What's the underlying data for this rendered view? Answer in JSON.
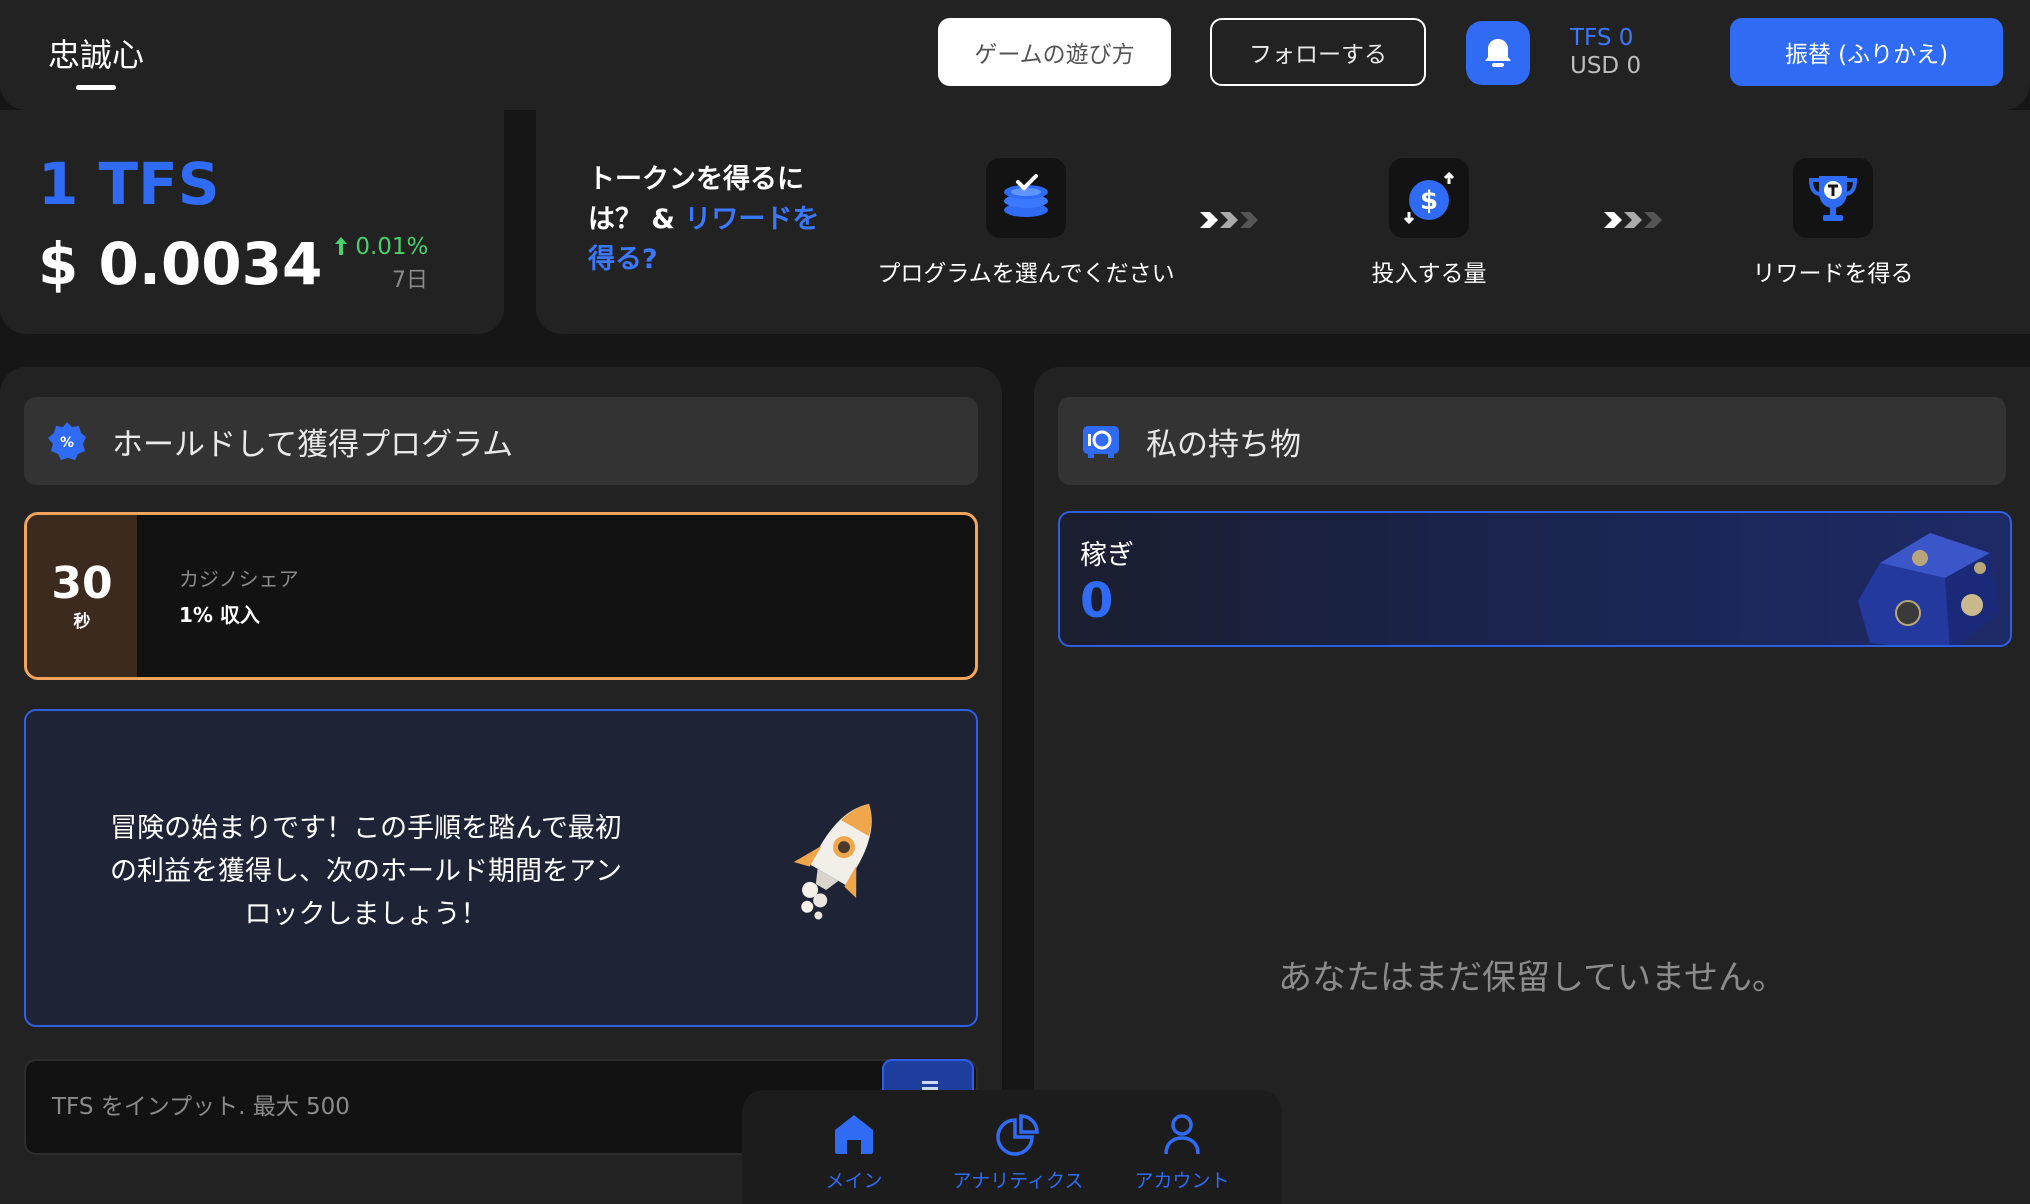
{
  "header": {
    "brand": "忠誠心",
    "how_to_play": "ゲームの遊び方",
    "follow": "フォローする",
    "tfs_balance": "TFS 0",
    "usd_balance": "USD 0",
    "transfer": "振替 (ふりかえ)"
  },
  "price": {
    "symbol": "1 TFS",
    "value": "$ 0.0034",
    "change": "0.01%",
    "period": "7日",
    "change_color": "#49d06c"
  },
  "steps": {
    "title_white": "トークンを得るには？ & ",
    "title_blue": "リワードを得る?",
    "items": [
      {
        "label": "プログラムを選んでください",
        "icon": "coin-stack-check-icon"
      },
      {
        "label": "投入する量",
        "icon": "dollar-deposit-icon"
      },
      {
        "label": "リワードを得る",
        "icon": "trophy-icon"
      }
    ]
  },
  "hold_program": {
    "heading": "ホールドして獲得プログラム",
    "card": {
      "timer_value": "30",
      "timer_unit": "秒",
      "name": "カジノシェア",
      "income": "1% 収入"
    },
    "intro": "冒険の始まりです！この手順を踏んで最初の利益を獲得し、次のホールド期間をアンロックしましょう！",
    "input_placeholder": "TFS をインプット. 最大 500"
  },
  "holdings": {
    "heading": "私の持ち物",
    "earn_label": "稼ぎ",
    "earn_value": "0",
    "empty_message": "あなたはまだ保留していません。"
  },
  "nav": {
    "items": [
      {
        "label": "メイン",
        "icon": "home-icon"
      },
      {
        "label": "アナリティクス",
        "icon": "pie-chart-icon"
      },
      {
        "label": "アカウント",
        "icon": "user-icon"
      }
    ]
  },
  "colors": {
    "accent": "#2f6bf5",
    "background": "#161616",
    "panel": "#222222",
    "highlight_border": "#f3a55b"
  }
}
